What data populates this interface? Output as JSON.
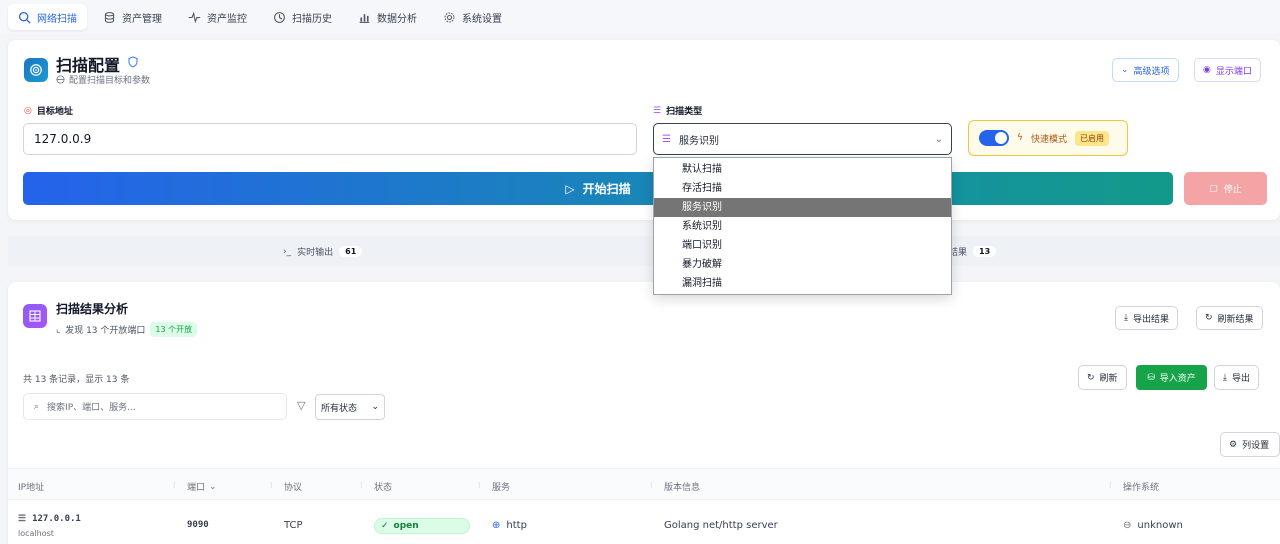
{
  "nav": {
    "tabs": [
      {
        "label": "网络扫描",
        "icon": "search-icon",
        "active": true
      },
      {
        "label": "资产管理",
        "icon": "database-icon"
      },
      {
        "label": "资产监控",
        "icon": "activity-icon"
      },
      {
        "label": "扫描历史",
        "icon": "history-icon"
      },
      {
        "label": "数据分析",
        "icon": "bar-chart-icon"
      },
      {
        "label": "系统设置",
        "icon": "gear-icon"
      }
    ]
  },
  "config": {
    "title": "扫描配置",
    "subtitle": "配置扫描目标和参数",
    "advanced_label": "高级选项",
    "show_ports_label": "显示端口",
    "target_label": "目标地址",
    "target_value": "127.0.0.9",
    "scan_type_label": "扫描类型",
    "scan_type_value": "服务识别",
    "quick_mode_label": "快速模式",
    "quick_mode_badge": "已启用",
    "start_label": "开始扫描",
    "stop_label": "停止"
  },
  "dropdown": {
    "options": [
      "默认扫描",
      "存活扫描",
      "服务识别",
      "系统识别",
      "端口识别",
      "暴力破解",
      "漏洞扫描"
    ],
    "selected_index": 2
  },
  "tabs_strip": {
    "realtime_label": "实时输出",
    "realtime_count": "61",
    "results_label": "结果",
    "results_count": "13"
  },
  "results": {
    "title": "扫描结果分析",
    "subtitle": "发现 13 个开放端口",
    "badge": "13 个开放",
    "export_label": "导出结果",
    "refresh_results_label": "刷新结果",
    "summary": "共 13 条记录，显示 13 条",
    "search_placeholder": "搜索IP、端口、服务...",
    "status_filter": "所有状态",
    "refresh_label": "刷新",
    "import_label": "导入资产",
    "export_small_label": "导出",
    "column_settings_label": "列设置",
    "columns": [
      "IP地址",
      "端口",
      "协议",
      "状态",
      "服务",
      "版本信息",
      "操作系统"
    ],
    "rows": [
      {
        "ip": "127.0.0.1",
        "host": "localhost",
        "port": "9090",
        "protocol": "TCP",
        "status": "open",
        "service": "http",
        "version": "Golang net/http server",
        "os": "unknown"
      }
    ]
  },
  "colors": {
    "accent": "#2563eb",
    "success": "#16a34a",
    "warning": "#f5c542",
    "danger": "#f4a4a4"
  }
}
